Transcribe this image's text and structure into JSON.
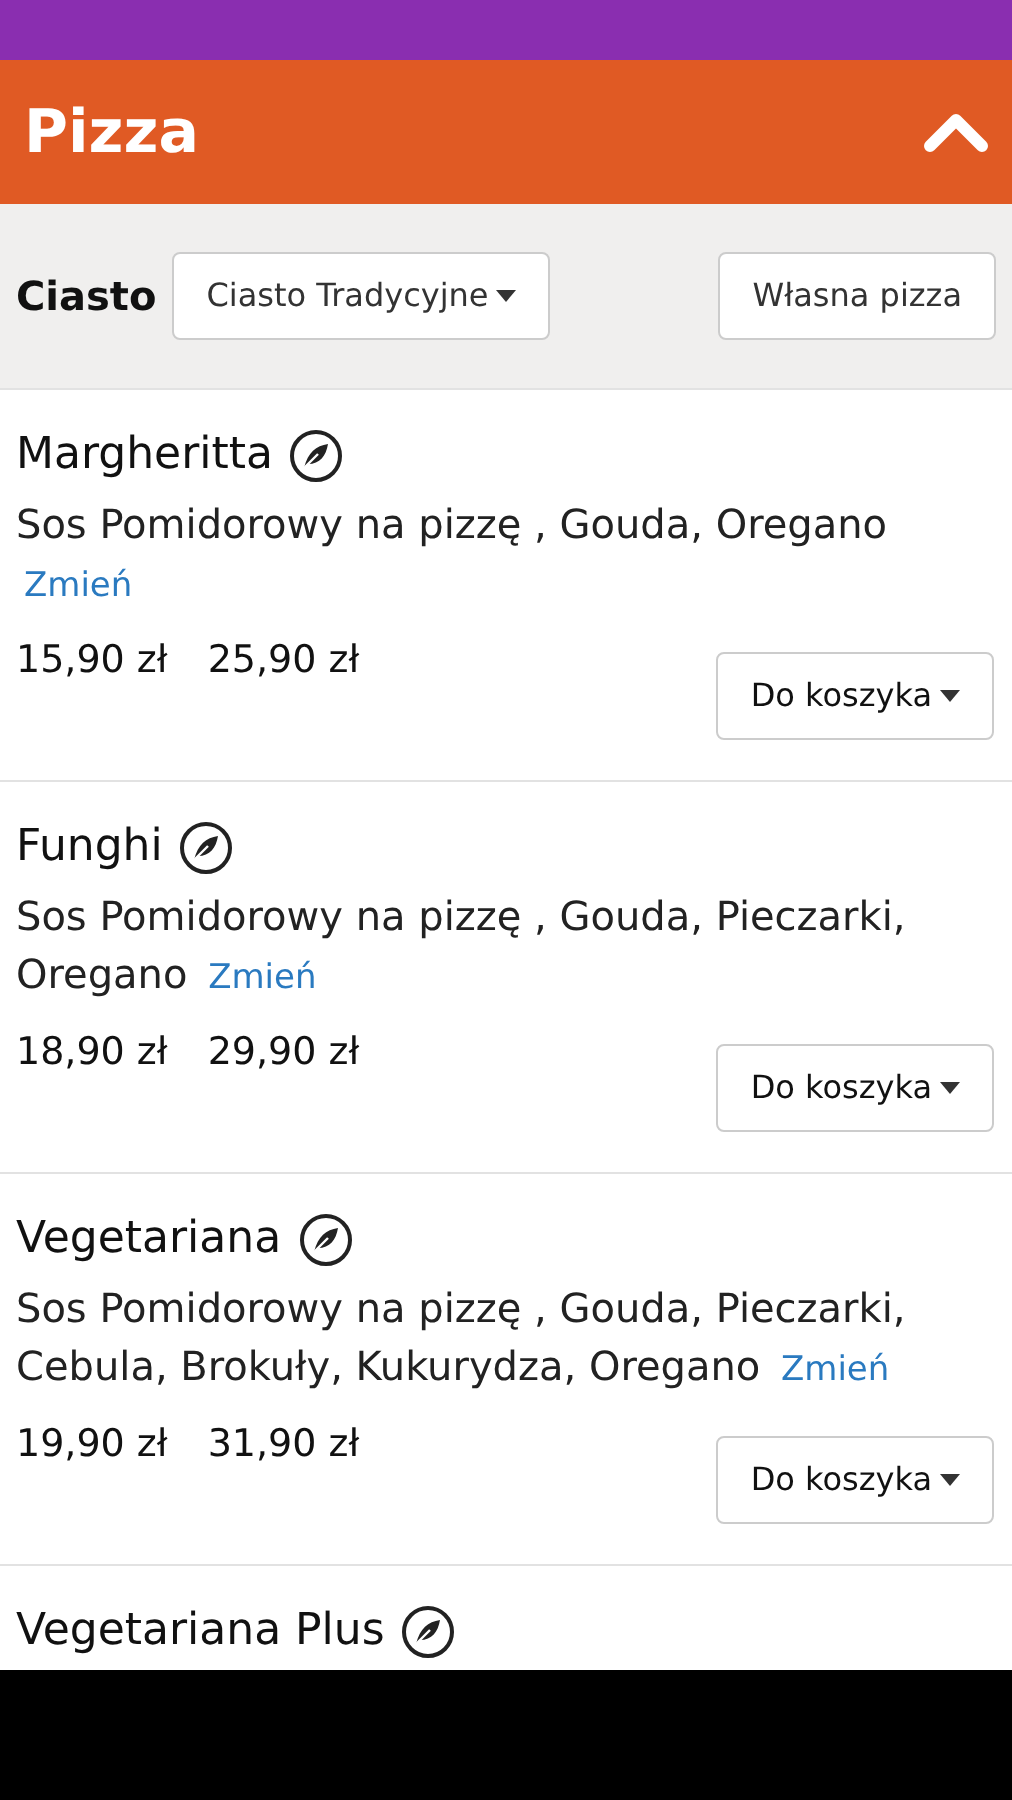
{
  "header": {
    "title": "Pizza",
    "expanded": true
  },
  "filter": {
    "label": "Ciasto",
    "dough": "Ciasto Tradycyjne",
    "custom_button": "Własna pizza"
  },
  "items": [
    {
      "name": "Margheritta",
      "vegetarian": true,
      "ingredients": "Sos Pomidorowy na pizzę , Gouda, Oregano",
      "change_link": "Zmień",
      "prices": [
        "15,90 zł",
        "25,90 zł"
      ],
      "button": "Do koszyka"
    },
    {
      "name": "Funghi",
      "vegetarian": true,
      "ingredients": "Sos Pomidorowy na pizzę , Gouda, Pieczarki, Oregano",
      "change_link": "Zmień",
      "prices": [
        "18,90 zł",
        "29,90 zł"
      ],
      "button": "Do koszyka"
    },
    {
      "name": "Vegetariana",
      "vegetarian": true,
      "ingredients": "Sos Pomidorowy na pizzę , Gouda, Pieczarki, Cebula, Brokuły, Kukurydza, Oregano",
      "change_link": "Zmień",
      "prices": [
        "19,90 zł",
        "31,90 zł"
      ],
      "button": "Do koszyka"
    },
    {
      "name": "Vegetariana Plus",
      "vegetarian": true
    }
  ]
}
